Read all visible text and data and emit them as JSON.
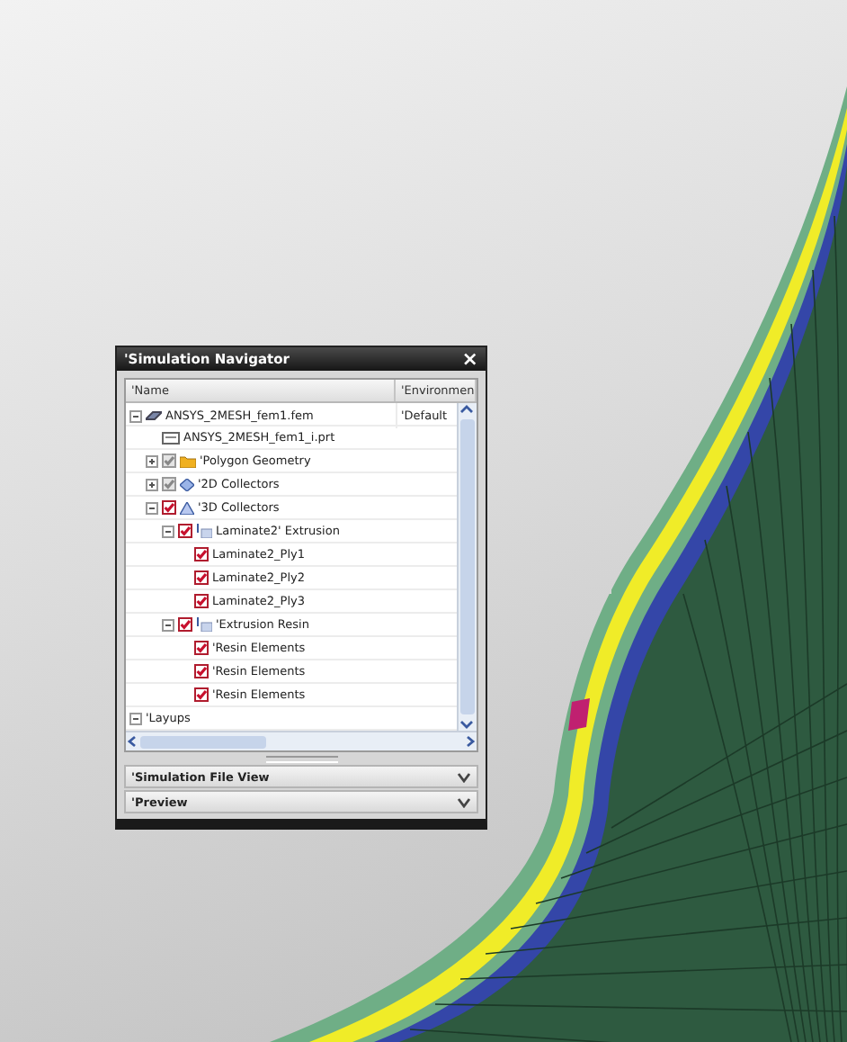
{
  "navigator": {
    "title": "'Simulation Navigator",
    "close": "×",
    "columns": [
      "'Name",
      "'Environmen"
    ],
    "tree": [
      {
        "label": "ANSYS_2MESH_fem1.fem",
        "env": "'Default",
        "kind": "fem",
        "expanded": true,
        "children": [
          {
            "label": "ANSYS_2MESH_fem1_i.prt",
            "kind": "part"
          },
          {
            "label": "'Polygon Geometry",
            "kind": "folder",
            "checked": true,
            "dimmed": true,
            "expanded": false
          },
          {
            "label": "'2D Collectors",
            "kind": "collector2d",
            "checked": true,
            "dimmed": true,
            "expanded": false
          },
          {
            "label": "'3D Collectors",
            "kind": "collector3d",
            "checked": true,
            "dimmed": false,
            "expanded": true,
            "children": [
              {
                "label": "Laminate2' Extrusion",
                "kind": "extrusion",
                "checked": true,
                "dimmed": false,
                "expanded": true,
                "children": [
                  {
                    "label": "Laminate2_Ply1",
                    "checked": true,
                    "dimmed": false
                  },
                  {
                    "label": "Laminate2_Ply2",
                    "checked": true,
                    "dimmed": false
                  },
                  {
                    "label": "Laminate2_Ply3",
                    "checked": true,
                    "dimmed": false
                  }
                ]
              },
              {
                "label": "'Extrusion Resin",
                "kind": "extrusion",
                "checked": true,
                "dimmed": false,
                "expanded": true,
                "children": [
                  {
                    "label": "'Resin Elements",
                    "checked": true,
                    "dimmed": false
                  },
                  {
                    "label": "'Resin Elements",
                    "checked": true,
                    "dimmed": false
                  },
                  {
                    "label": "'Resin Elements",
                    "checked": true,
                    "dimmed": false
                  }
                ]
              }
            ]
          }
        ]
      },
      {
        "label": "'Layups",
        "expanded": true
      }
    ],
    "sections": [
      {
        "label": "'Simulation File View",
        "expanded": false
      },
      {
        "label": "'Preview",
        "expanded": false
      }
    ]
  }
}
